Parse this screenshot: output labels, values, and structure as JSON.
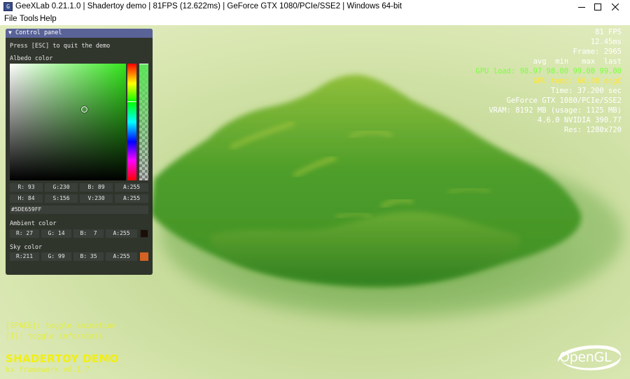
{
  "window": {
    "title": "GeeXLab 0.21.1.0 | Shadertoy demo | 81FPS (12.622ms) | GeForce GTX 1080/PCIe/SSE2 | Windows 64-bit",
    "icon": "geexlab-app-icon"
  },
  "menu": [
    "File",
    "Tools",
    "Help"
  ],
  "control_panel": {
    "title": "Control panel",
    "quit_hint": "Press [ESC] to quit the demo",
    "albedo": {
      "label": "Albedo color",
      "rgba": [
        "R: 93",
        "G:230",
        "B: 89",
        "A:255"
      ],
      "hsva": [
        "H: 84",
        "S:156",
        "V:230",
        "A:255"
      ],
      "hex": "#5DE659FF",
      "color": "#5de659"
    },
    "ambient": {
      "label": "Ambient color",
      "rgba": [
        "R: 27",
        "G: 14",
        "B:  7",
        "A:255"
      ],
      "color": "#1b0e07"
    },
    "sky": {
      "label": "Sky color",
      "rgba": [
        "R:211",
        "G: 99",
        "B: 35",
        "A:255"
      ],
      "color": "#d36323"
    }
  },
  "stats": {
    "fps": "81 FPS",
    "frame_time": "12.45ms",
    "frame": "Frame: 2965",
    "gpu_header": "avg  min   max  last",
    "gpu_load": "GPU load: 98.97 98.00 99.00 99.00",
    "gpu_temp": "GPU temp: 60.00 degC",
    "time": "Time: 37.200 sec",
    "gpu_name": "GeForce GTX 1080/PCIe/SSE2",
    "vram": "VRAM: 8192 MB (usage: 1125 MB)",
    "driver": "4.6.0 NVIDIA 390.77",
    "res": "Res: 1280x720"
  },
  "hints": {
    "space": "[SPACE]: toggle animation",
    "info": "[I]: toggle info/stats"
  },
  "demo": {
    "title": "SHADERTOY DEMO",
    "subtitle": "kx framework v0.1.7"
  },
  "logo": {
    "text": "OpenGL"
  },
  "colors": {
    "gpu_load": "#7cff3e",
    "gpu_temp": "#ffe636",
    "stats_text": "#ffffff",
    "hint_text": "#e5ef3a",
    "panel_header": "#5a6398"
  }
}
